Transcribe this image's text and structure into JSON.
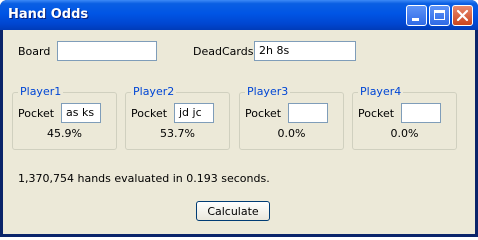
{
  "window": {
    "title": "Hand Odds"
  },
  "board": {
    "label": "Board",
    "value": ""
  },
  "dead_cards": {
    "label": "DeadCards",
    "value": "2h 8s"
  },
  "players": [
    {
      "name": "Player1",
      "pocket_label": "Pocket",
      "pocket": "as ks",
      "odds": "45.9%"
    },
    {
      "name": "Player2",
      "pocket_label": "Pocket",
      "pocket": "jd jc",
      "odds": "53.7%"
    },
    {
      "name": "Player3",
      "pocket_label": "Pocket",
      "pocket": "",
      "odds": "0.0%"
    },
    {
      "name": "Player4",
      "pocket_label": "Pocket",
      "pocket": "",
      "odds": "0.0%"
    }
  ],
  "status": "1,370,754 hands evaluated in 0.193 seconds.",
  "calculate_label": "Calculate"
}
